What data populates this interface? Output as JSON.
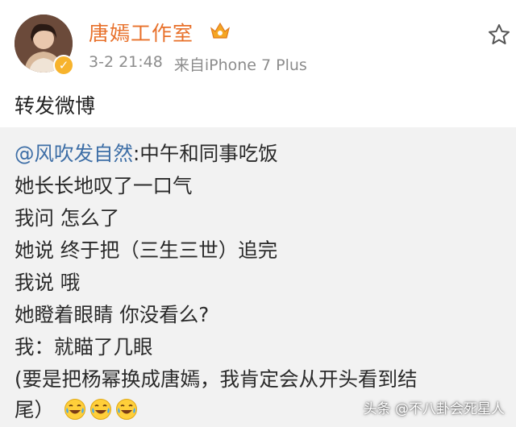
{
  "post": {
    "author_name": "唐嫣工作室",
    "timestamp": "3-2 21:48",
    "source": "来自iPhone 7 Plus",
    "text": "转发微博"
  },
  "repost": {
    "mention": "@风吹发自然",
    "lines": [
      ":中午和同事吃饭",
      "她长长地叹了一口气",
      "我问 怎么了",
      "她说 终于把（三生三世）追完",
      "我说 哦",
      "她瞪着眼睛 你没看么?",
      "我：就瞄了几眼",
      "(要是把杨幂换成唐嫣，我肯定会从开头看到结",
      "尾）"
    ]
  },
  "watermark": "头条 @不八卦会死星人",
  "colors": {
    "name": "#e8702a",
    "mention": "#3d6ea6",
    "meta": "#8c8c8c",
    "repost_bg": "#f2f2f2",
    "verified_badge": "#f7b32c"
  },
  "icons": [
    "verified-icon",
    "vip-crown-icon",
    "star-icon",
    "laugh-cry-emoji-icon"
  ]
}
